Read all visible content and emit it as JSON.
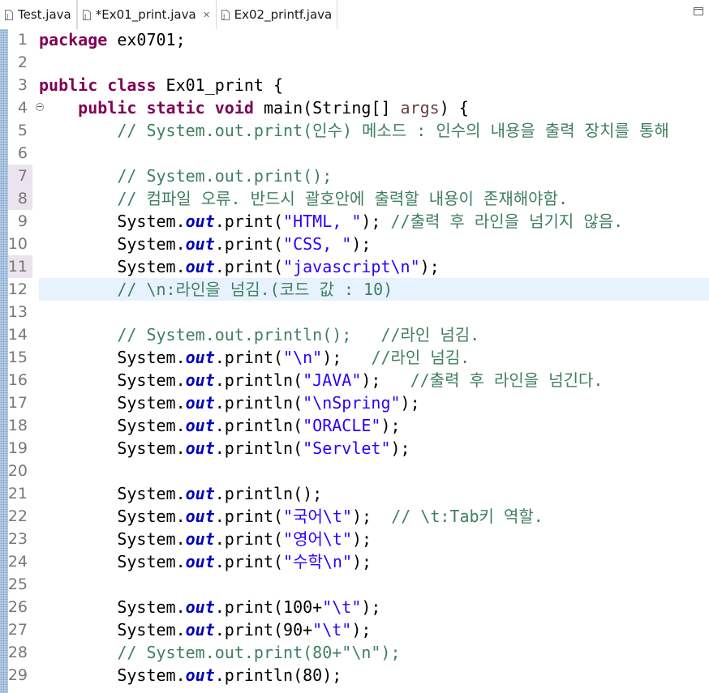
{
  "tabs": [
    {
      "label": "Test.java",
      "active": false,
      "icon": "java-file-icon"
    },
    {
      "label": "*Ex01_print.java",
      "active": true,
      "icon": "java-file-icon",
      "close_glyph": "✕"
    },
    {
      "label": "Ex02_printf.java",
      "active": false,
      "icon": "java-file-icon"
    }
  ],
  "window_controls": {
    "icon": "maximize-icon"
  },
  "colors": {
    "keyword": "#7f0055",
    "comment": "#3f7f5f",
    "string": "#2a00ff",
    "field": "#0000c0",
    "parameter": "#6a3e3e",
    "line_number": "#787878",
    "current_line": "#e8f2fe"
  },
  "editor": {
    "current_line": 12,
    "marked_lines": [
      7,
      8,
      11
    ],
    "fold_lines": [
      4
    ],
    "lines": [
      {
        "n": "1",
        "tokens": [
          {
            "t": "kw",
            "v": "package"
          },
          {
            "t": "pl",
            "v": " ex0701;"
          }
        ]
      },
      {
        "n": "2",
        "tokens": []
      },
      {
        "n": "3",
        "tokens": [
          {
            "t": "kw",
            "v": "public class"
          },
          {
            "t": "pl",
            "v": " Ex01_print {"
          }
        ]
      },
      {
        "n": "4",
        "tokens": [
          {
            "t": "pl",
            "v": "    "
          },
          {
            "t": "kw",
            "v": "public static void"
          },
          {
            "t": "pl",
            "v": " main(String[] "
          },
          {
            "t": "var",
            "v": "args"
          },
          {
            "t": "pl",
            "v": ") {"
          }
        ]
      },
      {
        "n": "5",
        "tokens": [
          {
            "t": "cm",
            "v": "        // System.out.print(인수) 메소드 : 인수의 내용을 출력 장치를 통해"
          }
        ]
      },
      {
        "n": "6",
        "tokens": []
      },
      {
        "n": "7",
        "tokens": [
          {
            "t": "cm",
            "v": "        // System.out.print();"
          }
        ]
      },
      {
        "n": "8",
        "tokens": [
          {
            "t": "cm",
            "v": "        // 컴파일 오류. 반드시 괄호안에 출력할 내용이 존재해야함."
          }
        ]
      },
      {
        "n": "9",
        "tokens": [
          {
            "t": "pl",
            "v": "        System."
          },
          {
            "t": "fld",
            "v": "out"
          },
          {
            "t": "pl",
            "v": ".print("
          },
          {
            "t": "str",
            "v": "\"HTML, \""
          },
          {
            "t": "pl",
            "v": "); "
          },
          {
            "t": "cm",
            "v": "//출력 후 라인을 넘기지 않음."
          }
        ]
      },
      {
        "n": "10",
        "tokens": [
          {
            "t": "pl",
            "v": "        System."
          },
          {
            "t": "fld",
            "v": "out"
          },
          {
            "t": "pl",
            "v": ".print("
          },
          {
            "t": "str",
            "v": "\"CSS, \""
          },
          {
            "t": "pl",
            "v": ");"
          }
        ]
      },
      {
        "n": "11",
        "tokens": [
          {
            "t": "pl",
            "v": "        System."
          },
          {
            "t": "fld",
            "v": "out"
          },
          {
            "t": "pl",
            "v": ".print("
          },
          {
            "t": "str",
            "v": "\"javascript\\n\""
          },
          {
            "t": "pl",
            "v": ");"
          }
        ]
      },
      {
        "n": "12",
        "tokens": [
          {
            "t": "cm",
            "v": "        // \\n:라인을 넘김.(코드 값 : 10)"
          }
        ]
      },
      {
        "n": "13",
        "tokens": []
      },
      {
        "n": "14",
        "tokens": [
          {
            "t": "cm",
            "v": "        // System.out.println();   //라인 넘김."
          }
        ]
      },
      {
        "n": "15",
        "tokens": [
          {
            "t": "pl",
            "v": "        System."
          },
          {
            "t": "fld",
            "v": "out"
          },
          {
            "t": "pl",
            "v": ".print("
          },
          {
            "t": "str",
            "v": "\"\\n\""
          },
          {
            "t": "pl",
            "v": ");   "
          },
          {
            "t": "cm",
            "v": "//라인 넘김."
          }
        ]
      },
      {
        "n": "16",
        "tokens": [
          {
            "t": "pl",
            "v": "        System."
          },
          {
            "t": "fld",
            "v": "out"
          },
          {
            "t": "pl",
            "v": ".println("
          },
          {
            "t": "str",
            "v": "\"JAVA\""
          },
          {
            "t": "pl",
            "v": ");   "
          },
          {
            "t": "cm",
            "v": "//출력 후 라인을 넘긴다."
          }
        ]
      },
      {
        "n": "17",
        "tokens": [
          {
            "t": "pl",
            "v": "        System."
          },
          {
            "t": "fld",
            "v": "out"
          },
          {
            "t": "pl",
            "v": ".println("
          },
          {
            "t": "str",
            "v": "\"\\nSpring\""
          },
          {
            "t": "pl",
            "v": ");"
          }
        ]
      },
      {
        "n": "18",
        "tokens": [
          {
            "t": "pl",
            "v": "        System."
          },
          {
            "t": "fld",
            "v": "out"
          },
          {
            "t": "pl",
            "v": ".println("
          },
          {
            "t": "str",
            "v": "\"ORACLE\""
          },
          {
            "t": "pl",
            "v": ");"
          }
        ]
      },
      {
        "n": "19",
        "tokens": [
          {
            "t": "pl",
            "v": "        System."
          },
          {
            "t": "fld",
            "v": "out"
          },
          {
            "t": "pl",
            "v": ".println("
          },
          {
            "t": "str",
            "v": "\"Servlet\""
          },
          {
            "t": "pl",
            "v": ");"
          }
        ]
      },
      {
        "n": "20",
        "tokens": []
      },
      {
        "n": "21",
        "tokens": [
          {
            "t": "pl",
            "v": "        System."
          },
          {
            "t": "fld",
            "v": "out"
          },
          {
            "t": "pl",
            "v": ".println();"
          }
        ]
      },
      {
        "n": "22",
        "tokens": [
          {
            "t": "pl",
            "v": "        System."
          },
          {
            "t": "fld",
            "v": "out"
          },
          {
            "t": "pl",
            "v": ".print("
          },
          {
            "t": "str",
            "v": "\"국어\\t\""
          },
          {
            "t": "pl",
            "v": ");  "
          },
          {
            "t": "cm",
            "v": "// \\t:Tab키 역할."
          }
        ]
      },
      {
        "n": "23",
        "tokens": [
          {
            "t": "pl",
            "v": "        System."
          },
          {
            "t": "fld",
            "v": "out"
          },
          {
            "t": "pl",
            "v": ".print("
          },
          {
            "t": "str",
            "v": "\"영어\\t\""
          },
          {
            "t": "pl",
            "v": ");"
          }
        ]
      },
      {
        "n": "24",
        "tokens": [
          {
            "t": "pl",
            "v": "        System."
          },
          {
            "t": "fld",
            "v": "out"
          },
          {
            "t": "pl",
            "v": ".print("
          },
          {
            "t": "str",
            "v": "\"수학\\n\""
          },
          {
            "t": "pl",
            "v": ");"
          }
        ]
      },
      {
        "n": "25",
        "tokens": []
      },
      {
        "n": "26",
        "tokens": [
          {
            "t": "pl",
            "v": "        System."
          },
          {
            "t": "fld",
            "v": "out"
          },
          {
            "t": "pl",
            "v": ".print(100+"
          },
          {
            "t": "str",
            "v": "\"\\t\""
          },
          {
            "t": "pl",
            "v": ");"
          }
        ]
      },
      {
        "n": "27",
        "tokens": [
          {
            "t": "pl",
            "v": "        System."
          },
          {
            "t": "fld",
            "v": "out"
          },
          {
            "t": "pl",
            "v": ".print(90+"
          },
          {
            "t": "str",
            "v": "\"\\t\""
          },
          {
            "t": "pl",
            "v": ");"
          }
        ]
      },
      {
        "n": "28",
        "tokens": [
          {
            "t": "cm",
            "v": "        // System.out.print(80+\"\\n\");"
          }
        ]
      },
      {
        "n": "29",
        "tokens": [
          {
            "t": "pl",
            "v": "        System."
          },
          {
            "t": "fld",
            "v": "out"
          },
          {
            "t": "pl",
            "v": ".println(80);"
          }
        ]
      }
    ]
  }
}
